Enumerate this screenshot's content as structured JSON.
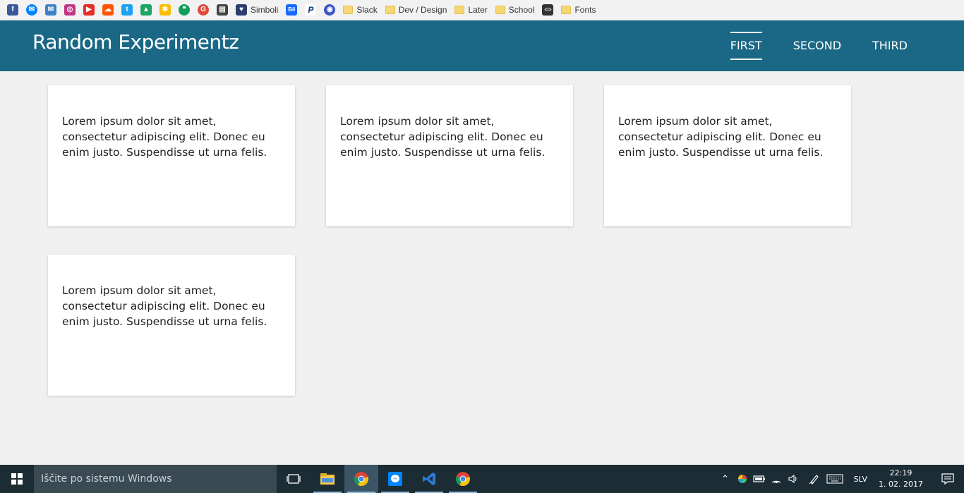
{
  "bookmarks": {
    "icons": [
      {
        "name": "facebook-icon",
        "glyph": "f",
        "color": "#3b5998"
      },
      {
        "name": "messenger-icon",
        "glyph": "✉",
        "color": "#0084ff"
      },
      {
        "name": "mail-icon",
        "glyph": "✉",
        "color": "#3e82c4"
      },
      {
        "name": "instagram-icon",
        "glyph": "◎",
        "color": "#c13584"
      },
      {
        "name": "youtube-icon",
        "glyph": "▶",
        "color": "#e52d27"
      },
      {
        "name": "soundcloud-icon",
        "glyph": "☁",
        "color": "#ff5500"
      },
      {
        "name": "twitter-icon",
        "glyph": "t",
        "color": "#1da1f2"
      },
      {
        "name": "google-drive-icon",
        "glyph": "▲",
        "color": "#1fa463"
      },
      {
        "name": "google-photos-icon",
        "glyph": "✱",
        "color": "#fbbc05"
      },
      {
        "name": "hangouts-icon",
        "glyph": "❝",
        "color": "#0f9d58"
      },
      {
        "name": "google-plus-icon",
        "glyph": "G",
        "color": "#dd4b39"
      },
      {
        "name": "film-icon",
        "glyph": "▤",
        "color": "#444444"
      }
    ],
    "simboli_label": "Simboli",
    "behance_glyph": "Bē",
    "paypal_glyph": "P",
    "pocket_glyph": "◉",
    "folders": [
      {
        "name": "bookmark-folder-slack",
        "label": "Slack"
      },
      {
        "name": "bookmark-folder-dev-design",
        "label": "Dev / Design"
      },
      {
        "name": "bookmark-folder-later",
        "label": "Later"
      },
      {
        "name": "bookmark-folder-school",
        "label": "School"
      }
    ],
    "code_glyph": "</>",
    "fonts_label": "Fonts"
  },
  "header": {
    "brand": "Random Experimentz",
    "nav": [
      {
        "label": "FIRST",
        "active": true
      },
      {
        "label": "SECOND",
        "active": false
      },
      {
        "label": "THIRD",
        "active": false
      }
    ]
  },
  "cards": [
    {
      "text": "Lorem ipsum dolor sit amet, consectetur adipiscing elit. Donec eu enim justo. Suspendisse ut urna felis."
    },
    {
      "text": "Lorem ipsum dolor sit amet, consectetur adipiscing elit. Donec eu enim justo. Suspendisse ut urna felis."
    },
    {
      "text": "Lorem ipsum dolor sit amet, consectetur adipiscing elit. Donec eu enim justo. Suspendisse ut urna felis."
    },
    {
      "text": "Lorem ipsum dolor sit amet, consectetur adipiscing elit. Donec eu enim justo. Suspendisse ut urna felis."
    }
  ],
  "taskbar": {
    "search_placeholder": "Iščite po sistemu Windows",
    "language": "SLV",
    "time": "22:19",
    "date": "1. 02. 2017"
  },
  "colors": {
    "header_bg": "#1b6886",
    "page_bg": "#f0f0f0",
    "taskbar_bg": "#1b2c35"
  }
}
